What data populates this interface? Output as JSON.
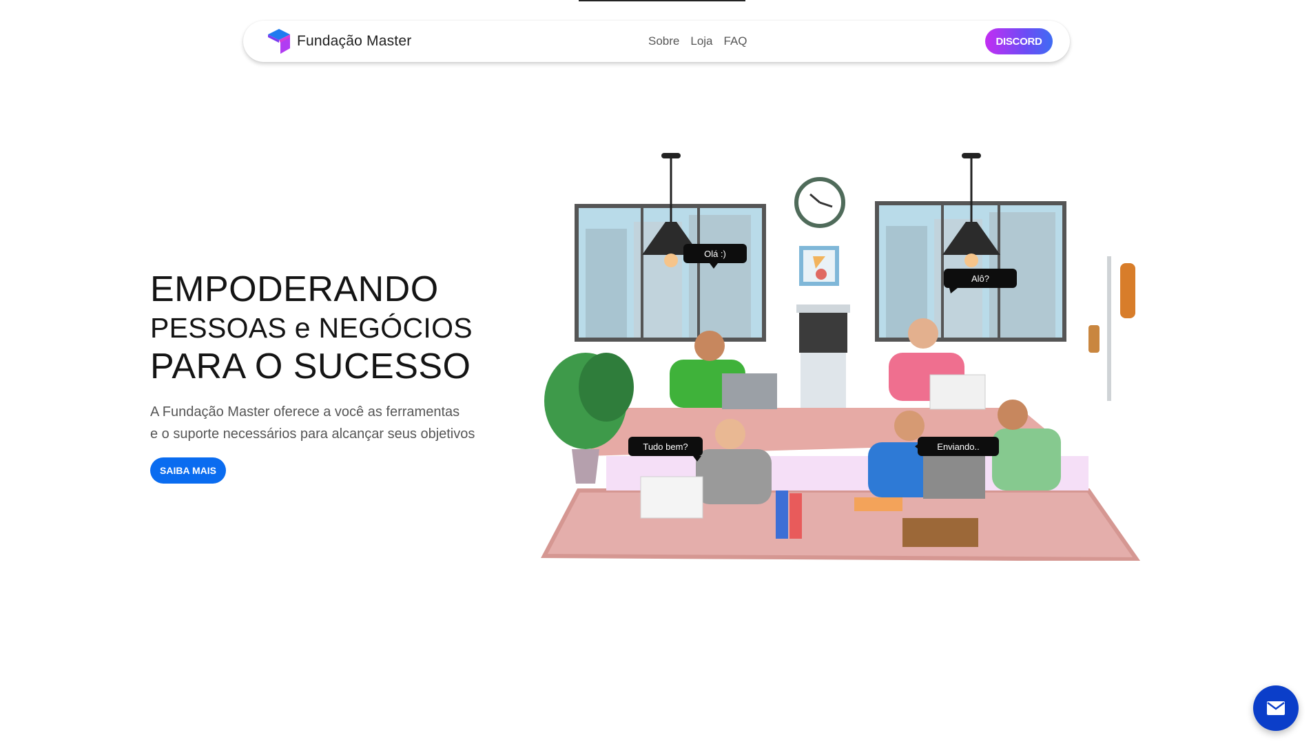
{
  "brand": {
    "name": "Fundação Master",
    "logo_icon": "cube-logo-icon"
  },
  "nav": {
    "links": [
      "Sobre",
      "Loja",
      "FAQ"
    ],
    "discord_label": "DISCORD"
  },
  "hero": {
    "title_line1": "EMPODERANDO",
    "title_line2": "PESSOAS e NEGÓCIOS",
    "title_line3": "PARA O SUCESSO",
    "subtitle_line1": "A Fundação Master oferece a você as ferramentas",
    "subtitle_line2": "e o suporte necessários para alcançar seus objetivos",
    "cta_label": "SAIBA MAIS"
  },
  "illustration": {
    "bubbles": [
      "Olá :)",
      "Alô?",
      "Tudo bem?",
      "Enviando.."
    ]
  },
  "colors": {
    "accent_blue": "#0a6cf0",
    "discord_gradient_start": "#c32ef2",
    "discord_gradient_end": "#3f6cf3",
    "fab_blue": "#0b3ec9"
  },
  "fab": {
    "icon": "mail-icon"
  }
}
